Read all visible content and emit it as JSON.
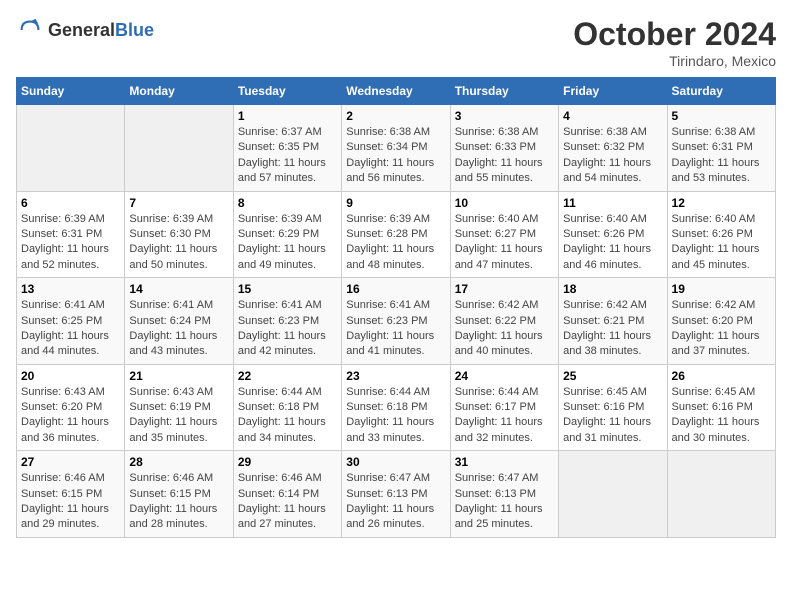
{
  "header": {
    "logo_general": "General",
    "logo_blue": "Blue",
    "month": "October 2024",
    "location": "Tirindaro, Mexico"
  },
  "days_of_week": [
    "Sunday",
    "Monday",
    "Tuesday",
    "Wednesday",
    "Thursday",
    "Friday",
    "Saturday"
  ],
  "weeks": [
    [
      {
        "day": "",
        "info": ""
      },
      {
        "day": "",
        "info": ""
      },
      {
        "day": "1",
        "info": "Sunrise: 6:37 AM\nSunset: 6:35 PM\nDaylight: 11 hours and 57 minutes."
      },
      {
        "day": "2",
        "info": "Sunrise: 6:38 AM\nSunset: 6:34 PM\nDaylight: 11 hours and 56 minutes."
      },
      {
        "day": "3",
        "info": "Sunrise: 6:38 AM\nSunset: 6:33 PM\nDaylight: 11 hours and 55 minutes."
      },
      {
        "day": "4",
        "info": "Sunrise: 6:38 AM\nSunset: 6:32 PM\nDaylight: 11 hours and 54 minutes."
      },
      {
        "day": "5",
        "info": "Sunrise: 6:38 AM\nSunset: 6:31 PM\nDaylight: 11 hours and 53 minutes."
      }
    ],
    [
      {
        "day": "6",
        "info": "Sunrise: 6:39 AM\nSunset: 6:31 PM\nDaylight: 11 hours and 52 minutes."
      },
      {
        "day": "7",
        "info": "Sunrise: 6:39 AM\nSunset: 6:30 PM\nDaylight: 11 hours and 50 minutes."
      },
      {
        "day": "8",
        "info": "Sunrise: 6:39 AM\nSunset: 6:29 PM\nDaylight: 11 hours and 49 minutes."
      },
      {
        "day": "9",
        "info": "Sunrise: 6:39 AM\nSunset: 6:28 PM\nDaylight: 11 hours and 48 minutes."
      },
      {
        "day": "10",
        "info": "Sunrise: 6:40 AM\nSunset: 6:27 PM\nDaylight: 11 hours and 47 minutes."
      },
      {
        "day": "11",
        "info": "Sunrise: 6:40 AM\nSunset: 6:26 PM\nDaylight: 11 hours and 46 minutes."
      },
      {
        "day": "12",
        "info": "Sunrise: 6:40 AM\nSunset: 6:26 PM\nDaylight: 11 hours and 45 minutes."
      }
    ],
    [
      {
        "day": "13",
        "info": "Sunrise: 6:41 AM\nSunset: 6:25 PM\nDaylight: 11 hours and 44 minutes."
      },
      {
        "day": "14",
        "info": "Sunrise: 6:41 AM\nSunset: 6:24 PM\nDaylight: 11 hours and 43 minutes."
      },
      {
        "day": "15",
        "info": "Sunrise: 6:41 AM\nSunset: 6:23 PM\nDaylight: 11 hours and 42 minutes."
      },
      {
        "day": "16",
        "info": "Sunrise: 6:41 AM\nSunset: 6:23 PM\nDaylight: 11 hours and 41 minutes."
      },
      {
        "day": "17",
        "info": "Sunrise: 6:42 AM\nSunset: 6:22 PM\nDaylight: 11 hours and 40 minutes."
      },
      {
        "day": "18",
        "info": "Sunrise: 6:42 AM\nSunset: 6:21 PM\nDaylight: 11 hours and 38 minutes."
      },
      {
        "day": "19",
        "info": "Sunrise: 6:42 AM\nSunset: 6:20 PM\nDaylight: 11 hours and 37 minutes."
      }
    ],
    [
      {
        "day": "20",
        "info": "Sunrise: 6:43 AM\nSunset: 6:20 PM\nDaylight: 11 hours and 36 minutes."
      },
      {
        "day": "21",
        "info": "Sunrise: 6:43 AM\nSunset: 6:19 PM\nDaylight: 11 hours and 35 minutes."
      },
      {
        "day": "22",
        "info": "Sunrise: 6:44 AM\nSunset: 6:18 PM\nDaylight: 11 hours and 34 minutes."
      },
      {
        "day": "23",
        "info": "Sunrise: 6:44 AM\nSunset: 6:18 PM\nDaylight: 11 hours and 33 minutes."
      },
      {
        "day": "24",
        "info": "Sunrise: 6:44 AM\nSunset: 6:17 PM\nDaylight: 11 hours and 32 minutes."
      },
      {
        "day": "25",
        "info": "Sunrise: 6:45 AM\nSunset: 6:16 PM\nDaylight: 11 hours and 31 minutes."
      },
      {
        "day": "26",
        "info": "Sunrise: 6:45 AM\nSunset: 6:16 PM\nDaylight: 11 hours and 30 minutes."
      }
    ],
    [
      {
        "day": "27",
        "info": "Sunrise: 6:46 AM\nSunset: 6:15 PM\nDaylight: 11 hours and 29 minutes."
      },
      {
        "day": "28",
        "info": "Sunrise: 6:46 AM\nSunset: 6:15 PM\nDaylight: 11 hours and 28 minutes."
      },
      {
        "day": "29",
        "info": "Sunrise: 6:46 AM\nSunset: 6:14 PM\nDaylight: 11 hours and 27 minutes."
      },
      {
        "day": "30",
        "info": "Sunrise: 6:47 AM\nSunset: 6:13 PM\nDaylight: 11 hours and 26 minutes."
      },
      {
        "day": "31",
        "info": "Sunrise: 6:47 AM\nSunset: 6:13 PM\nDaylight: 11 hours and 25 minutes."
      },
      {
        "day": "",
        "info": ""
      },
      {
        "day": "",
        "info": ""
      }
    ]
  ]
}
